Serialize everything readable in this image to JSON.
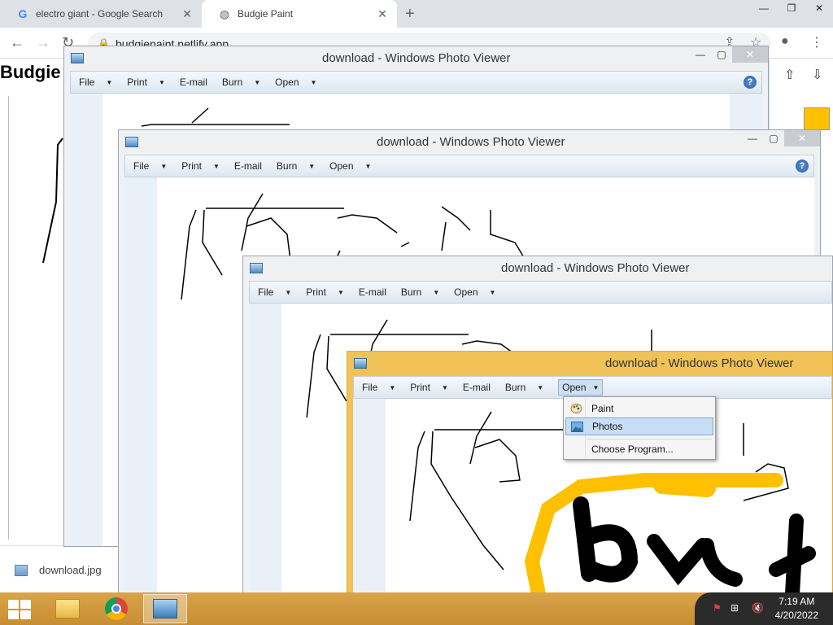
{
  "browser": {
    "tabs": [
      {
        "title": "electro giant - Google Search",
        "favicon": "google-g-icon"
      },
      {
        "title": "Budgie Paint",
        "favicon": "globe-icon"
      }
    ],
    "url": "budgiepaint.netlify.app"
  },
  "page": {
    "heading": "Budgie"
  },
  "downloads": {
    "file": "download.jpg"
  },
  "viewer": {
    "title": "download - Windows Photo Viewer",
    "menu": {
      "file": "File",
      "print": "Print",
      "email": "E-mail",
      "burn": "Burn",
      "open": "Open"
    },
    "help": "?"
  },
  "open_menu": {
    "items": [
      "Paint",
      "Photos",
      "Choose Program..."
    ],
    "highlighted": "Photos"
  },
  "taskbar": {
    "time": "7:19 AM",
    "date": "4/20/2022"
  },
  "colors": {
    "accent": "#f0c257",
    "highlight": "#c9def5",
    "paint_yellow": "#ffc000"
  }
}
